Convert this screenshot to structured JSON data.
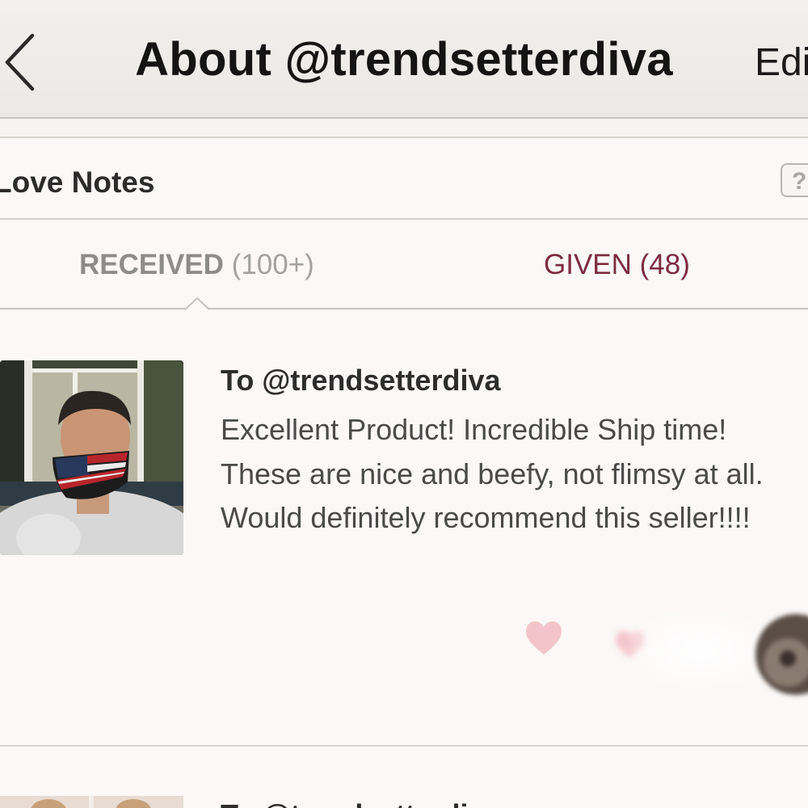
{
  "header": {
    "title": "About @trendsetterdiva",
    "edit_label": "Edi"
  },
  "section": {
    "title": "Love Notes",
    "help_label": "?"
  },
  "tabs": [
    {
      "label": "RECEIVED",
      "count": "(100+)",
      "selected": true
    },
    {
      "label": "GIVEN (48)",
      "selected": false
    }
  ],
  "notes": [
    {
      "to": "To @trendsetterdiva",
      "body": "Excellent Product! Incredible Ship time! These are nice and beefy, not flimsy at all. Would definitely recommend this seller!!!!"
    },
    {
      "to": "To @trendsetterdiva"
    }
  ],
  "colors": {
    "accent": "#7d2b40",
    "heart": "#f3c5cb",
    "background": "#fbf8f7"
  },
  "icons": {
    "back": "chevron-left-icon",
    "help": "question-mark-icon",
    "like": "heart-icon",
    "tab_pointer": "caret-up-icon"
  }
}
